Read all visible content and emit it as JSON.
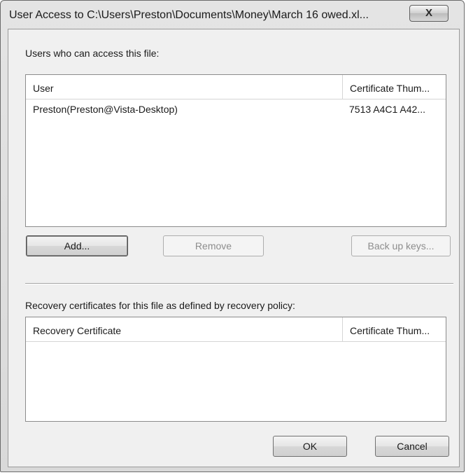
{
  "window": {
    "title": "User Access to C:\\Users\\Preston\\Documents\\Money\\March 16 owed.xl...",
    "close_label": "X"
  },
  "users_section": {
    "label": "Users who can access this file:",
    "columns": [
      "User",
      "Certificate Thum..."
    ],
    "rows": [
      {
        "user": "Preston(Preston@Vista-Desktop)",
        "thumbprint": "7513 A4C1 A42..."
      }
    ]
  },
  "buttons": {
    "add": "Add...",
    "remove": "Remove",
    "backup": "Back up keys...",
    "ok": "OK",
    "cancel": "Cancel"
  },
  "recovery_section": {
    "label": "Recovery certificates for this file as defined by recovery policy:",
    "columns": [
      "Recovery Certificate",
      "Certificate Thum..."
    ],
    "rows": []
  }
}
